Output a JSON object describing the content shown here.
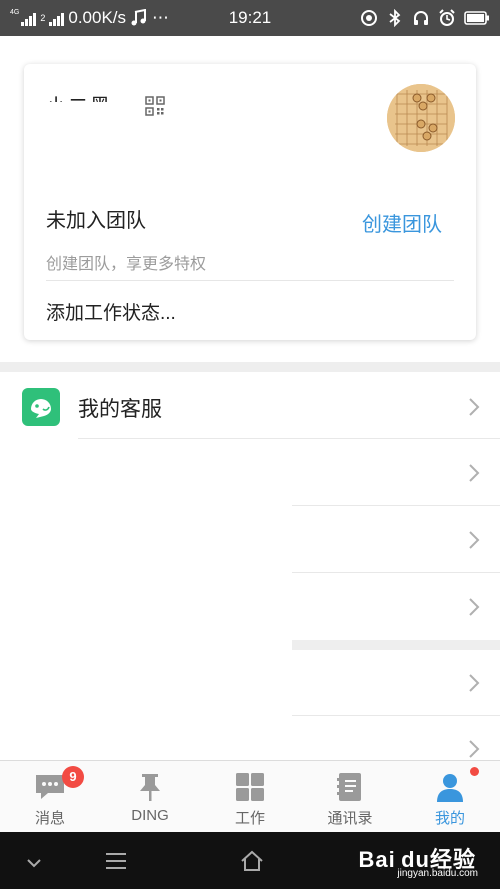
{
  "status_bar": {
    "network_type": "4G",
    "sim_tag": "2",
    "speed": "0.00K/s",
    "more": "⋯",
    "time": "19:21"
  },
  "profile_card": {
    "user_name": "小二黑",
    "team_status": "未加入团队",
    "create_team_label": "创建团队",
    "team_hint": "创建团队，享更多特权",
    "work_status": "添加工作状态..."
  },
  "menu": {
    "items": [
      {
        "label": "我的客服",
        "icon": "customer-service-icon"
      },
      {
        "label": "",
        "icon": ""
      },
      {
        "label": "",
        "icon": ""
      },
      {
        "label": "",
        "icon": ""
      },
      {
        "label": "",
        "icon": ""
      },
      {
        "label": "",
        "icon": ""
      }
    ]
  },
  "tab_bar": {
    "tabs": [
      {
        "label": "消息",
        "icon": "message-icon",
        "badge": "9"
      },
      {
        "label": "DING",
        "icon": "pin-icon"
      },
      {
        "label": "工作",
        "icon": "grid-icon"
      },
      {
        "label": "通讯录",
        "icon": "contacts-icon"
      },
      {
        "label": "我的",
        "icon": "person-icon",
        "active": true
      }
    ]
  },
  "watermark": {
    "brand": "Bai du经验",
    "url": "jingyan.baidu.com"
  },
  "colors": {
    "accent": "#3a96dd",
    "badge": "#f24b43",
    "service_icon": "#2fc07a",
    "status_bar": "#4a4a4a",
    "nav_bar": "#111111"
  }
}
